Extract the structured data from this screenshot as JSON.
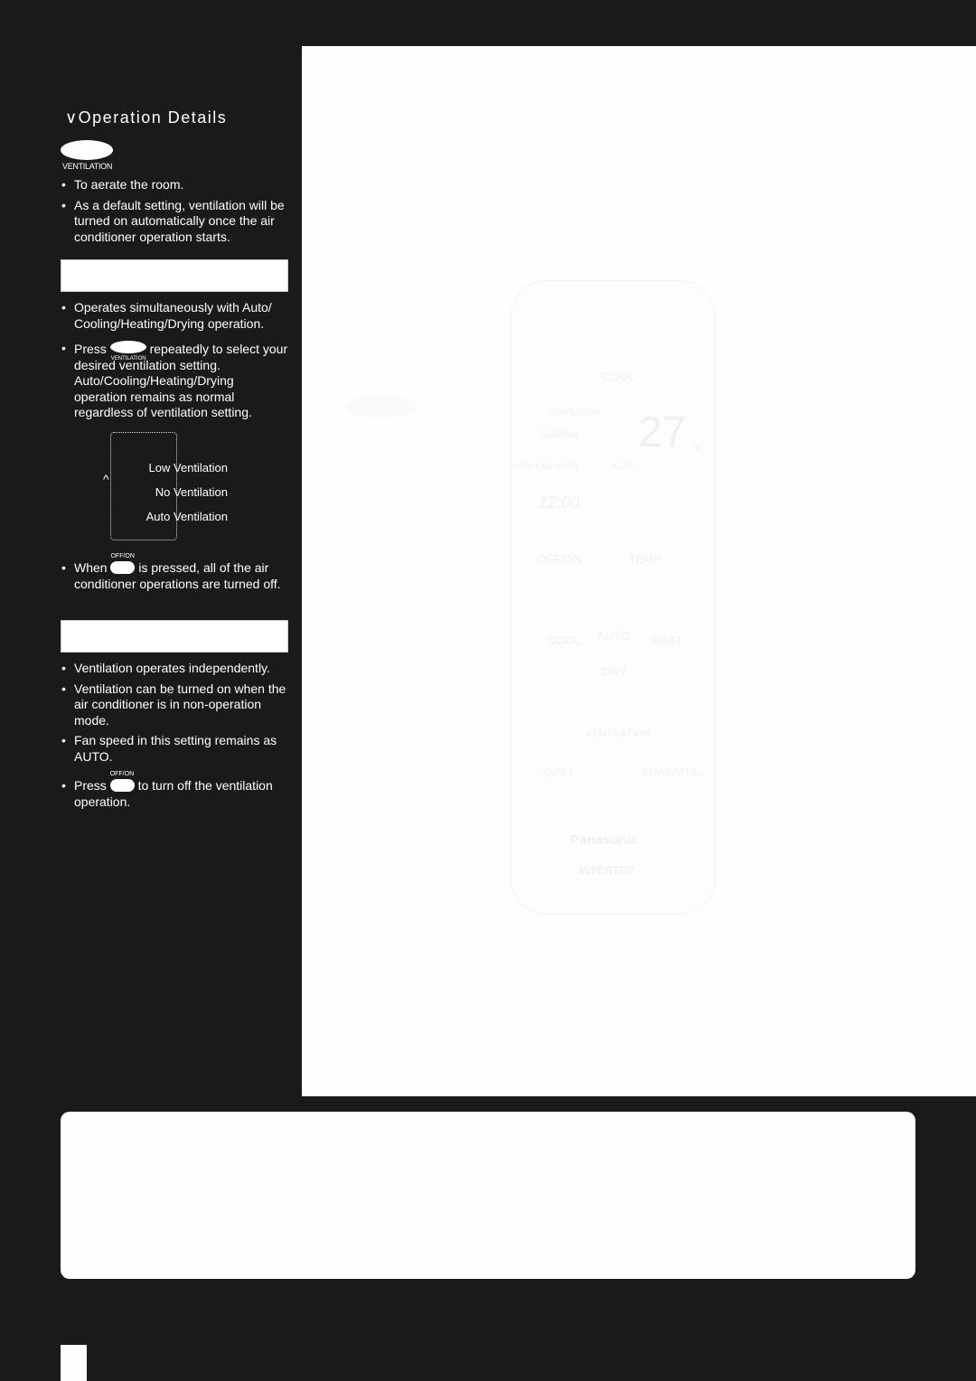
{
  "section_title": "∨Operation Details",
  "ventilation_button_label": "VENTILATION",
  "intro_bullets": [
    "To aerate the room.",
    "As a default setting, ventilation will be turned on automatically once the air conditioner operation starts."
  ],
  "section1": {
    "header": "",
    "bullet1": "Operates simultaneously with Auto/ Cooling/Heating/Drying operation.",
    "bullet2_pre": "Press",
    "bullet2_post": "repeatedly to select your desired ventilation setting. Auto/Cooling/Heating/Drying operation remains as normal regardless of ventilation setting.",
    "inline_button_label": "VENTILATION",
    "cycle": [
      "Low Ventilation",
      "No Ventilation",
      "Auto Ventilation"
    ],
    "bullet3_pre": "When",
    "bullet3_post": "is pressed, all of the air conditioner operations are turned off.",
    "offon_label": "OFF/ON"
  },
  "section2": {
    "header": "",
    "bullets": [
      "Ventilation operates independently.",
      "Ventilation can be turned on when the air conditioner is in non-operation mode.",
      "Fan speed in this setting remains as AUTO."
    ],
    "press_pre": "Press",
    "press_post": "to turn off the ventilation operation.",
    "offon_label": "OFF/ON"
  },
  "remote": {
    "mode": "COOL",
    "ventilation_indicator": "VENTILATION",
    "sleeping": "SLEEPING",
    "temperature": "27",
    "unit": "°C",
    "fan": "AUTO FAN",
    "fan_value": "AUTO",
    "swing": "AUTO",
    "clock": "12:00",
    "offon": "OFF/ON",
    "temp": "TEMP",
    "modes": [
      "COOL",
      "AUTO",
      "HEAT",
      "DRY"
    ],
    "ventilation": "VENTILATION",
    "quiet": "QUIET",
    "powerful": "POWERFUL",
    "brand": "Panasonic",
    "sub_brand": "INVERTER"
  }
}
